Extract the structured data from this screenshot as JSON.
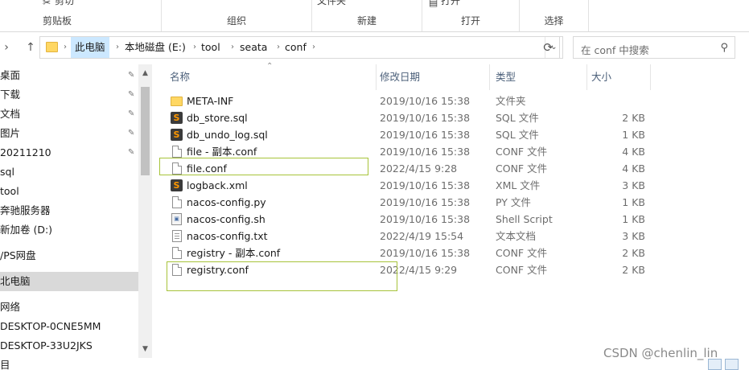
{
  "ribbon": {
    "groups": [
      {
        "label": "剪贴板",
        "top": "剪切"
      },
      {
        "label": "组织",
        "top": ""
      },
      {
        "label": "新建",
        "top": "文件夹"
      },
      {
        "label": "打开",
        "top": "打开"
      },
      {
        "label": "选择",
        "top": ""
      }
    ]
  },
  "address": {
    "crumbs": [
      "此电脑",
      "本地磁盘 (E:)",
      "tool",
      "seata",
      "conf"
    ],
    "search_placeholder": "在 conf 中搜索"
  },
  "nav": {
    "items": [
      {
        "label": "桌面",
        "pinned": true
      },
      {
        "label": "下载",
        "pinned": true
      },
      {
        "label": "文档",
        "pinned": true
      },
      {
        "label": "图片",
        "pinned": true
      },
      {
        "label": "20211210",
        "pinned": true
      },
      {
        "label": "sql",
        "pinned": false
      },
      {
        "label": "tool",
        "pinned": false
      },
      {
        "label": "奔驰服务器",
        "pinned": false
      },
      {
        "label": "新加卷 (D:)",
        "pinned": false
      },
      {
        "label": "/PS网盘",
        "pinned": false
      },
      {
        "label": "北电脑",
        "pinned": false
      },
      {
        "label": "网络",
        "pinned": false
      },
      {
        "label": "DESKTOP-0CNE5MM",
        "pinned": false
      },
      {
        "label": "DESKTOP-33U2JKS",
        "pinned": false
      },
      {
        "label": "目",
        "pinned": false
      }
    ]
  },
  "columns": {
    "name": "名称",
    "date": "修改日期",
    "type": "类型",
    "size": "大小"
  },
  "files": [
    {
      "name": "META-INF",
      "date": "2019/10/16 15:38",
      "type": "文件夹",
      "size": "",
      "icon": "folder-icon"
    },
    {
      "name": "db_store.sql",
      "date": "2019/10/16 15:38",
      "type": "SQL 文件",
      "size": "2 KB",
      "icon": "sublime-icon"
    },
    {
      "name": "db_undo_log.sql",
      "date": "2019/10/16 15:38",
      "type": "SQL 文件",
      "size": "1 KB",
      "icon": "sublime-icon"
    },
    {
      "name": "file - 副本.conf",
      "date": "2019/10/16 15:38",
      "type": "CONF 文件",
      "size": "4 KB",
      "icon": "file-icon"
    },
    {
      "name": "file.conf",
      "date": "2022/4/15 9:28",
      "type": "CONF 文件",
      "size": "4 KB",
      "icon": "file-icon"
    },
    {
      "name": "logback.xml",
      "date": "2019/10/16 15:38",
      "type": "XML 文件",
      "size": "3 KB",
      "icon": "sublime-icon"
    },
    {
      "name": "nacos-config.py",
      "date": "2019/10/16 15:38",
      "type": "PY 文件",
      "size": "1 KB",
      "icon": "file-icon"
    },
    {
      "name": "nacos-config.sh",
      "date": "2019/10/16 15:38",
      "type": "Shell Script",
      "size": "1 KB",
      "icon": "shell-icon"
    },
    {
      "name": "nacos-config.txt",
      "date": "2022/4/19 15:54",
      "type": "文本文档",
      "size": "3 KB",
      "icon": "text-file-icon"
    },
    {
      "name": "registry - 副本.conf",
      "date": "2019/10/16 15:38",
      "type": "CONF 文件",
      "size": "2 KB",
      "icon": "file-icon"
    },
    {
      "name": "registry.conf",
      "date": "2022/4/15 9:29",
      "type": "CONF 文件",
      "size": "2 KB",
      "icon": "file-icon"
    }
  ],
  "watermark": "CSDN @chenlin_lin",
  "colors": {
    "selection": "#cce8ff",
    "highlight_box": "#a7c33a",
    "header_text": "#4c607a",
    "folder": "#ffd763"
  }
}
